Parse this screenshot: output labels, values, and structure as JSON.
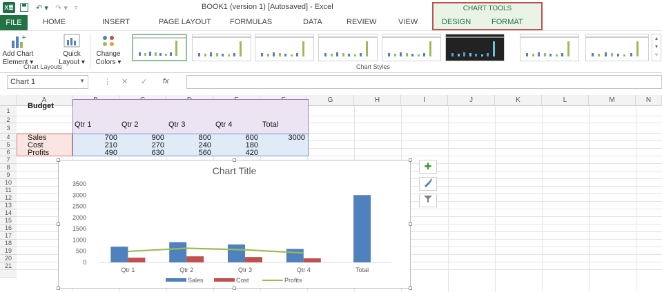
{
  "window": {
    "title": "BOOK1 (version 1) [Autosaved] - Excel",
    "app_logo": "X≣",
    "chart_tools_label": "CHART TOOLS"
  },
  "tabs": [
    "FILE",
    "HOME",
    "INSERT",
    "PAGE LAYOUT",
    "FORMULAS",
    "DATA",
    "REVIEW",
    "VIEW",
    "DESIGN",
    "FORMAT"
  ],
  "ribbon": {
    "add_chart_element": [
      "Add Chart",
      "Element ▾"
    ],
    "quick_layout": [
      "Quick",
      "Layout ▾"
    ],
    "change_colors": [
      "Change",
      "Colors ▾"
    ],
    "group_chart_layouts": "Chart Layouts",
    "group_chart_styles": "Chart Styles"
  },
  "formula_bar": {
    "name_box": "Chart 1",
    "fx": "fx",
    "value": ""
  },
  "columns": [
    "A",
    "B",
    "C",
    "D",
    "E",
    "F",
    "G",
    "H",
    "I",
    "J",
    "K",
    "L",
    "M",
    "N"
  ],
  "rows": [
    "1",
    "2",
    "3",
    "4",
    "5",
    "6",
    "7",
    "8",
    "9",
    "10",
    "11",
    "12",
    "13",
    "14",
    "15",
    "16",
    "17",
    "18",
    "19",
    "20",
    "21"
  ],
  "sheet": {
    "a1": "Budget",
    "headers": [
      "Qtr 1",
      "Qtr 2",
      "Qtr 3",
      "Qtr 4",
      "Total"
    ],
    "row_labels": [
      "Sales",
      "Cost",
      "Profits"
    ],
    "sales": [
      "700",
      "900",
      "800",
      "600",
      "3000"
    ],
    "cost": [
      "210",
      "270",
      "240",
      "180"
    ],
    "profits": [
      "490",
      "630",
      "560",
      "420"
    ]
  },
  "chart_data": {
    "type": "bar",
    "title": "Chart Title",
    "categories": [
      "Qtr 1",
      "Qtr 2",
      "Qtr 3",
      "Qtr 4",
      "Total"
    ],
    "series": [
      {
        "name": "Sales",
        "type": "bar",
        "color": "#4f81bd",
        "values": [
          700,
          900,
          800,
          600,
          3000
        ]
      },
      {
        "name": "Cost",
        "type": "bar",
        "color": "#c0504d",
        "values": [
          210,
          270,
          240,
          180,
          null
        ]
      },
      {
        "name": "Profits",
        "type": "line",
        "color": "#9bbb59",
        "values": [
          490,
          630,
          560,
          420,
          null
        ]
      }
    ],
    "y_ticks": [
      "0",
      "500",
      "1000",
      "1500",
      "2000",
      "2500",
      "3000",
      "3500"
    ],
    "ylim": [
      0,
      3500
    ],
    "grid": false,
    "legend_position": "bottom"
  },
  "icons": {
    "add_element": "plus-icon",
    "styles": "brush-icon",
    "filter": "filter-icon"
  }
}
